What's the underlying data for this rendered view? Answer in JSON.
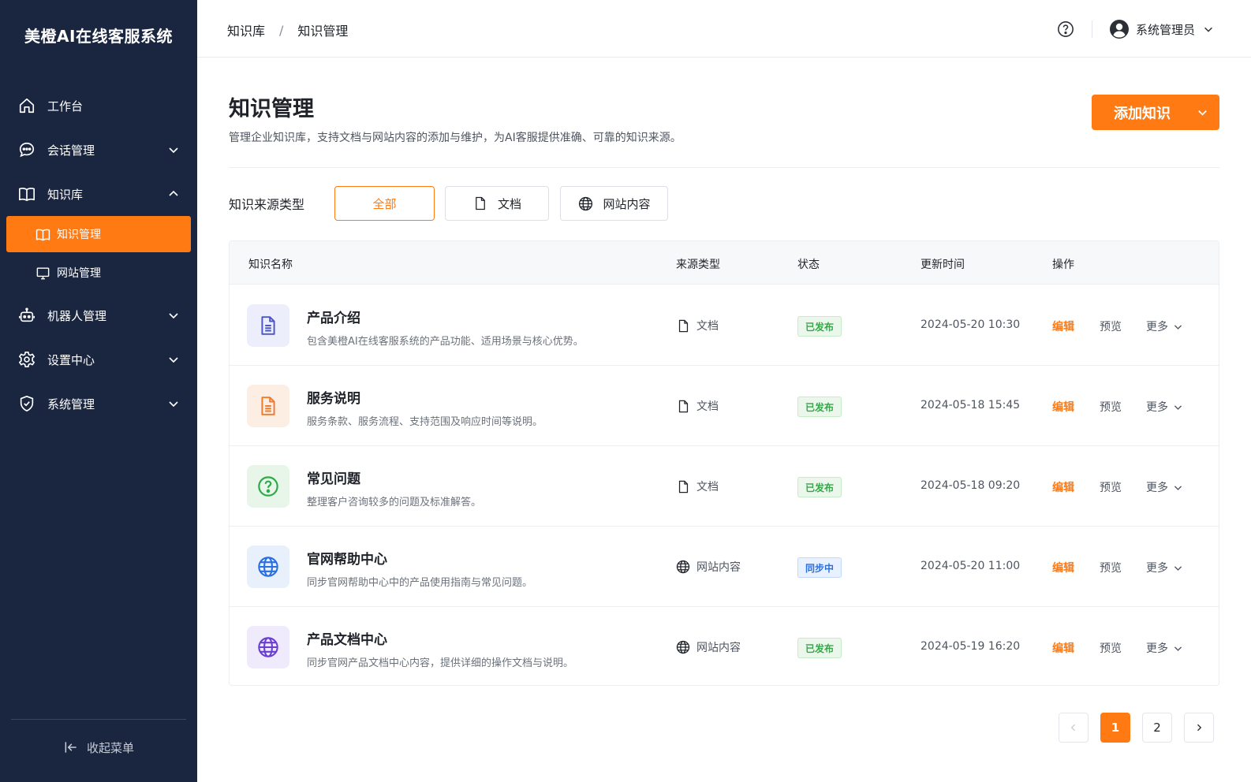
{
  "app": {
    "brand": "美橙AI在线客服系统"
  },
  "sidebar": {
    "items": [
      {
        "label": "工作台",
        "icon": "home-icon"
      },
      {
        "label": "会话管理",
        "icon": "chat-icon"
      },
      {
        "label": "知识库",
        "icon": "book-icon"
      },
      {
        "label": "机器人管理",
        "icon": "robot-icon"
      },
      {
        "label": "设置中心",
        "icon": "gear-icon"
      },
      {
        "label": "系统管理",
        "icon": "shield-icon"
      }
    ],
    "subitems": [
      {
        "label": "知识管理",
        "icon": "book-icon",
        "active": true
      },
      {
        "label": "网站管理",
        "icon": "monitor-icon",
        "active": false
      }
    ],
    "collapse_label": "收起菜单"
  },
  "header": {
    "breadcrumb": [
      "知识库",
      "知识管理"
    ],
    "breadcrumb_sep": "/",
    "user_name": "系统管理员"
  },
  "main": {
    "title": "知识管理",
    "description": "管理企业知识库，支持文档与网站内容的添加与维护，为AI客服提供准确、可靠的知识来源。",
    "add_button": "添加知识",
    "filter": {
      "label": "知识来源类型",
      "options": [
        {
          "label": "全部",
          "active": true
        },
        {
          "label": "文档",
          "icon": "file-icon"
        },
        {
          "label": "网站内容",
          "icon": "globe-icon"
        }
      ]
    },
    "table": {
      "columns": [
        "知识名称",
        "来源类型",
        "状态",
        "更新时间",
        "操作"
      ],
      "rows": [
        {
          "title": "产品介绍",
          "desc": "包含美橙AI在线客服系统的产品功能、适用场景与核心优势。",
          "type": "文档",
          "status": "已发布",
          "time": "2024-05-20 10:30",
          "icon": "document-icon",
          "icon_color": "#4a55c8",
          "icon_bg": "#eceefc"
        },
        {
          "title": "服务说明",
          "desc": "服务条款、服务流程、支持范围及响应时间等说明。",
          "type": "文档",
          "status": "已发布",
          "time": "2024-05-18 15:45",
          "icon": "document-icon",
          "icon_color": "#f07a2a",
          "icon_bg": "#fdeee3"
        },
        {
          "title": "常见问题",
          "desc": "整理客户咨询较多的问题及标准解答。",
          "type": "文档",
          "status": "已发布",
          "time": "2024-05-18 09:20",
          "icon": "question-icon",
          "icon_color": "#2eaa4a",
          "icon_bg": "#e8f6ea"
        },
        {
          "title": "官网帮助中心",
          "desc": "同步官网帮助中心中的产品使用指南与常见问题。",
          "type": "网站内容",
          "status": "同步中",
          "time": "2024-05-20 11:00",
          "icon": "globe-icon",
          "icon_color": "#2a6fe0",
          "icon_bg": "#e8f0fc"
        },
        {
          "title": "产品文档中心",
          "desc": "同步官网产品文档中心内容，提供详细的操作文档与说明。",
          "type": "网站内容",
          "status": "已发布",
          "time": "2024-05-19 16:20",
          "icon": "globe-icon",
          "icon_color": "#6a3fd0",
          "icon_bg": "#efeafc"
        }
      ],
      "actions": {
        "edit": "编辑",
        "preview": "预览",
        "more": "更多"
      }
    },
    "pagination": {
      "pages": [
        "1",
        "2"
      ],
      "current": "1"
    }
  },
  "colors": {
    "accent": "#ff7a12",
    "sidebar_bg": "#1a2640",
    "published": "#35a84a",
    "syncing": "#2a6fe0"
  }
}
